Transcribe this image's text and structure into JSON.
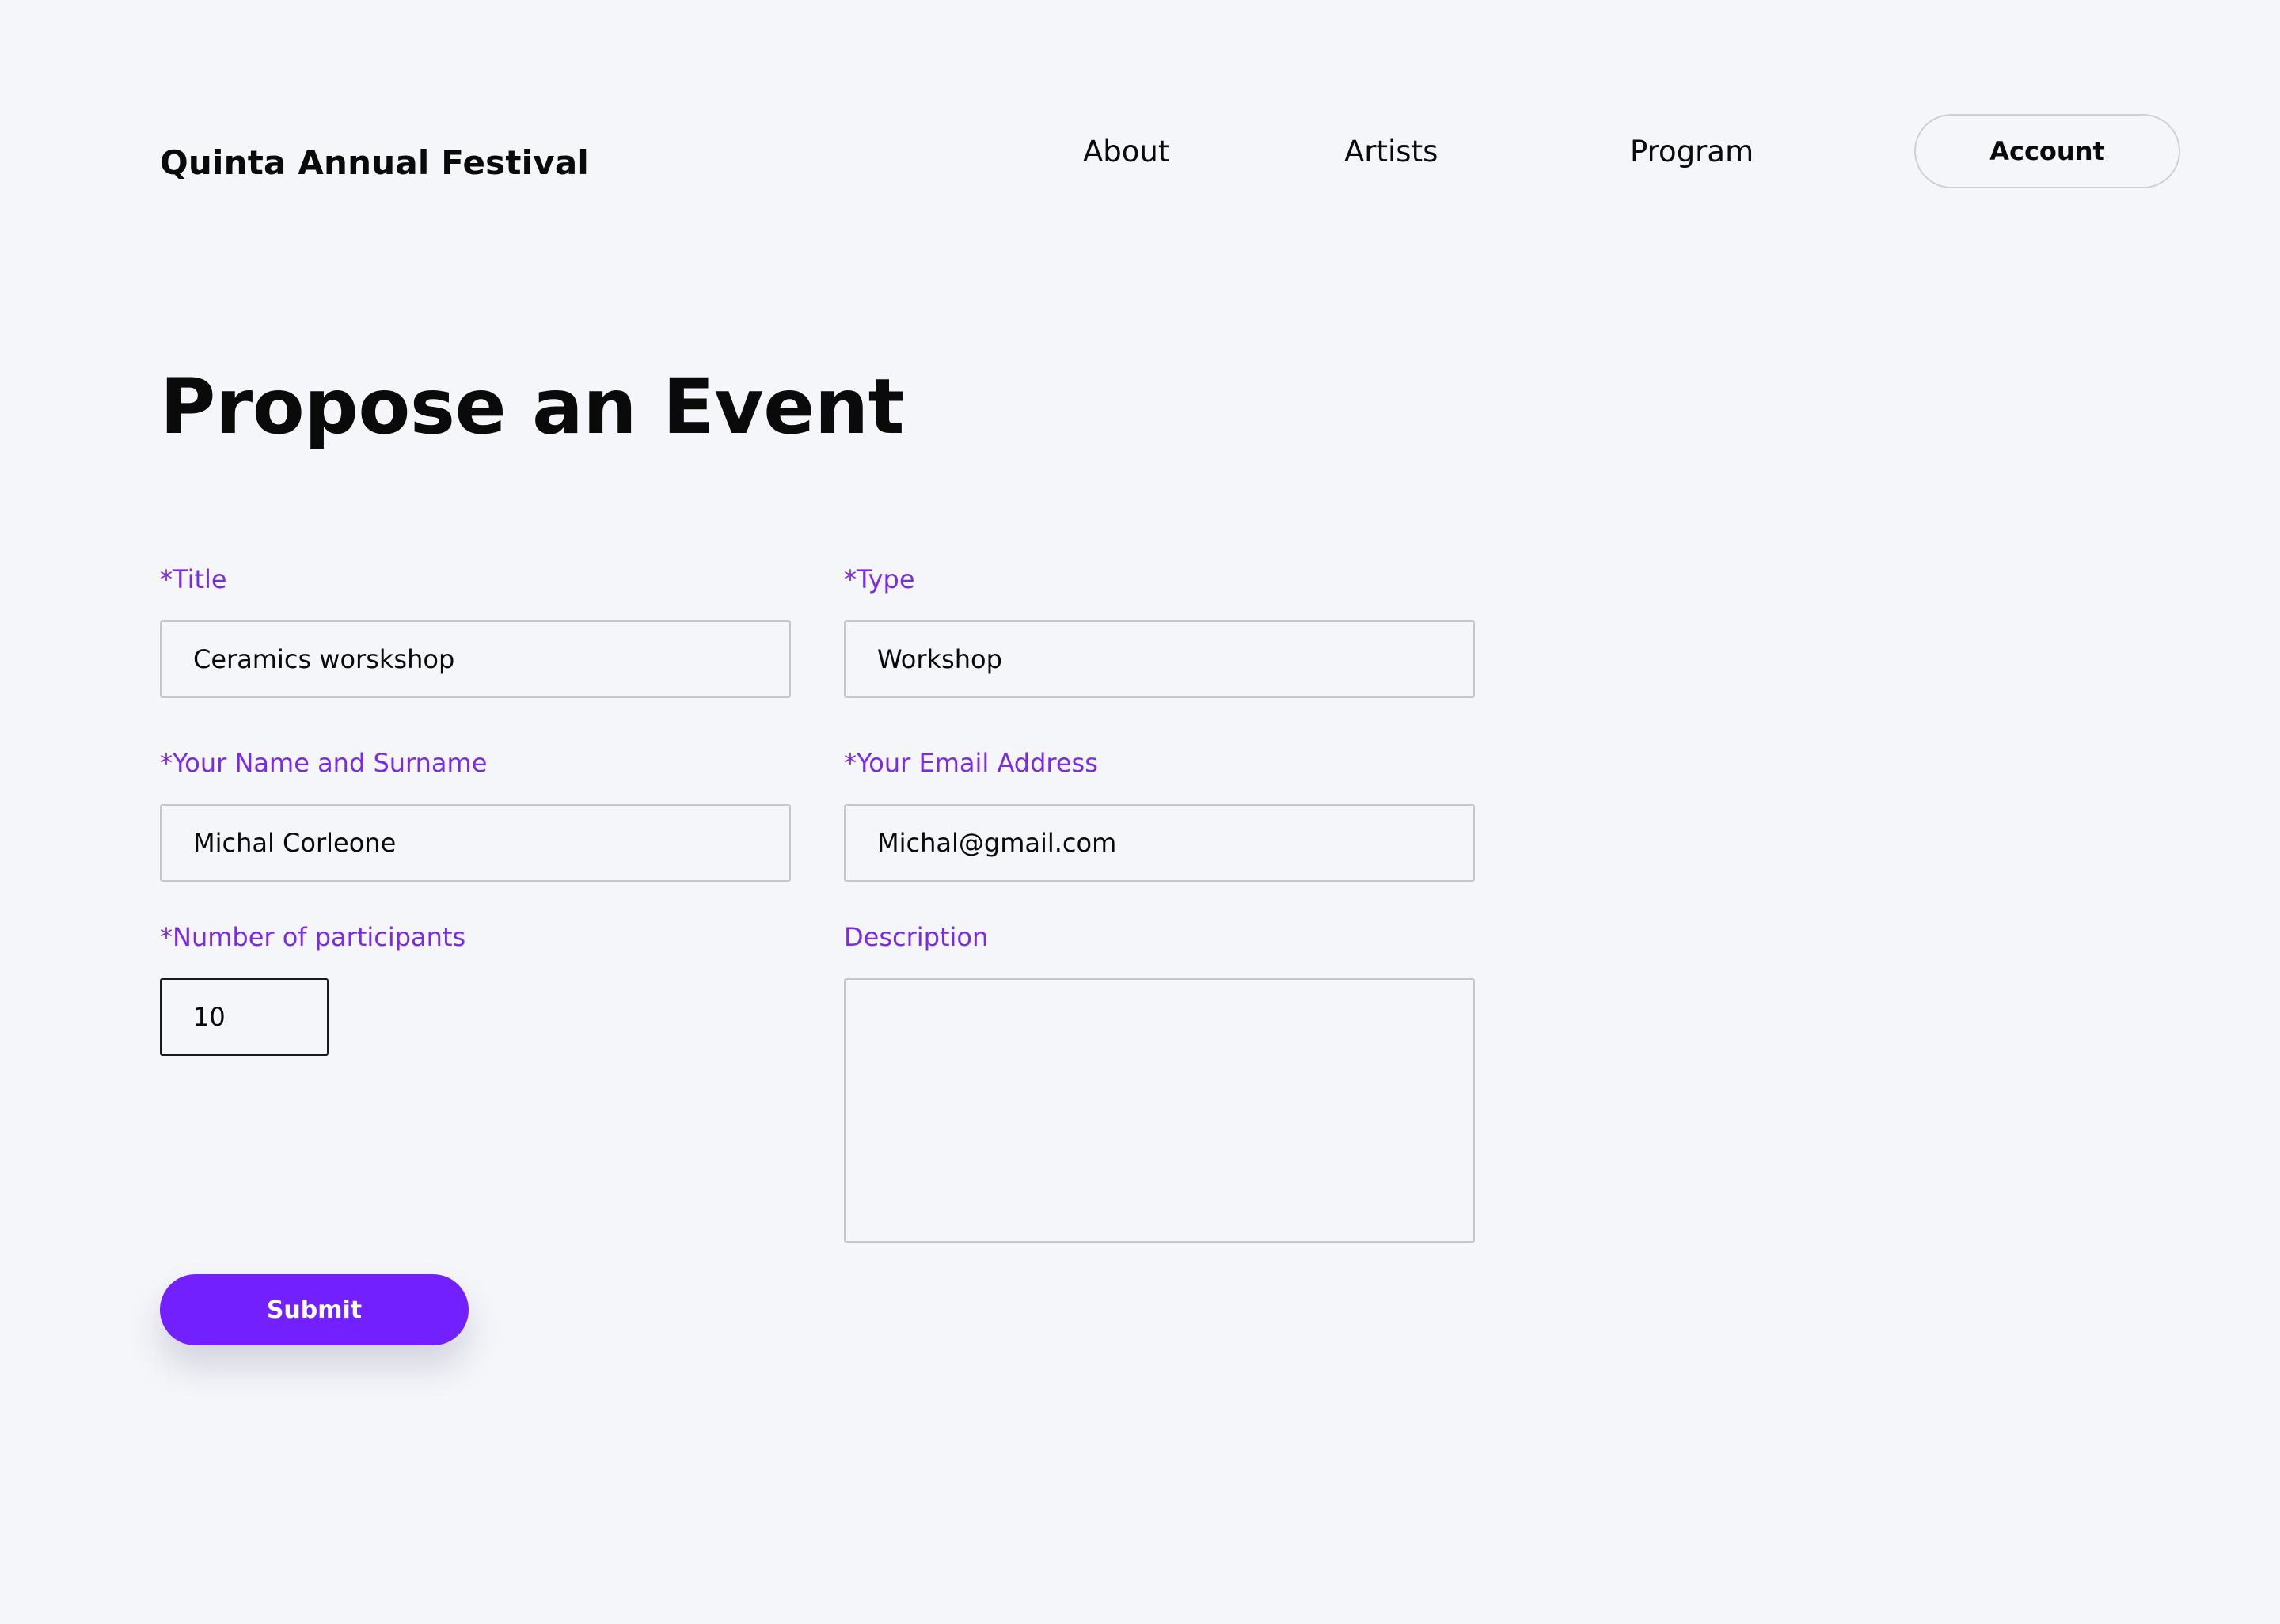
{
  "header": {
    "brand": "Quinta Annual Festival",
    "nav": {
      "about": "About",
      "artists": "Artists",
      "program": "Program"
    },
    "account_label": "Account"
  },
  "page": {
    "title": "Propose an Event"
  },
  "form": {
    "title": {
      "label": "*Title",
      "value": "Ceramics worskshop"
    },
    "type": {
      "label": "*Type",
      "value": "Workshop"
    },
    "name": {
      "label": "*Your Name and Surname",
      "value": "Michal Corleone"
    },
    "email": {
      "label": "*Your Email Address",
      "value": "Michal@gmail.com"
    },
    "participants": {
      "label": "*Number of participants",
      "value": "10"
    },
    "description": {
      "label": "Description",
      "value": ""
    },
    "submit_label": "Submit"
  },
  "colors": {
    "accent": "#7320ff",
    "label": "#7b2be6",
    "background": "#f5f6fa"
  }
}
